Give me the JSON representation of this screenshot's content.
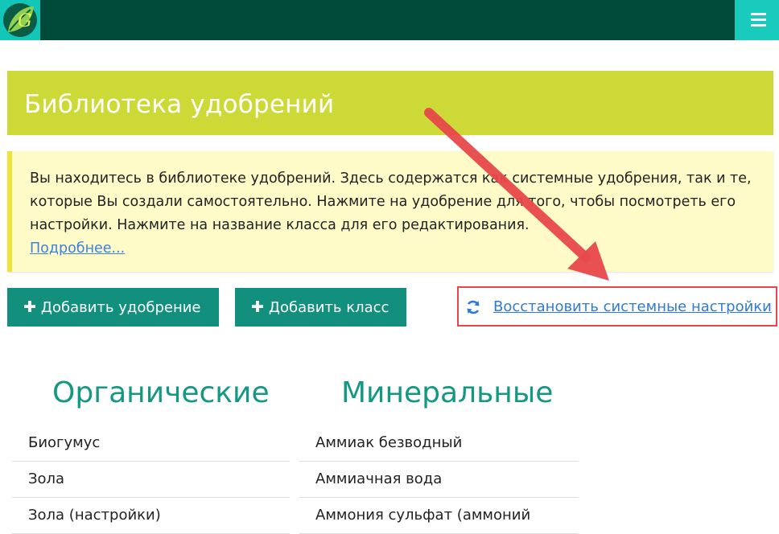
{
  "header": {
    "logo_icon": "leaf-logo-icon",
    "menu_icon": "hamburger-icon",
    "colors": {
      "bar": "#004a3a",
      "accent": "#19cbbd"
    }
  },
  "page": {
    "title": "Библиотека удобрений",
    "title_bg": "#cdd936"
  },
  "info": {
    "text": "Вы находитесь в библиотеке удобрений. Здесь содержатся как системные удобрения, так и те, которые Вы создали самостоятельно. Нажмите на удобрение для того, чтобы посмотреть его настройки. Нажмите на название класса для его редактирования.",
    "more_link": "Подробнее..."
  },
  "actions": {
    "add_fertilizer": "Добавить удобрение",
    "add_class": "Добавить класс",
    "restore": "Восстановить системные настройки",
    "restore_icon": "refresh-icon"
  },
  "columns": {
    "organic": {
      "title": "Органические",
      "items": [
        "Биогумус",
        "Зола",
        "Зола (настройки)"
      ]
    },
    "mineral": {
      "title": "Минеральные",
      "items": [
        "Аммиак безводный",
        "Аммиачная вода",
        "Аммония сульфат (аммоний"
      ]
    }
  }
}
